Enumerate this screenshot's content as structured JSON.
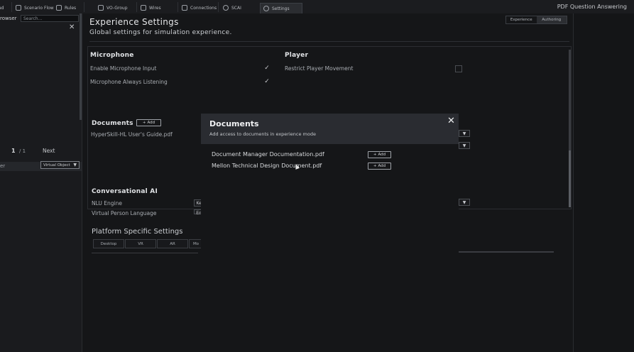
{
  "topbar": {
    "tabs": [
      {
        "label": "ad",
        "icon": "grid-icon"
      },
      {
        "label": "Scenario Flow",
        "icon": "flow-icon"
      },
      {
        "label": "Rules",
        "icon": "rules-icon"
      },
      {
        "label": "VO-Group",
        "icon": "vo-group-icon"
      },
      {
        "label": "Wires",
        "icon": "wires-icon"
      },
      {
        "label": "Connections",
        "icon": "connections-icon"
      },
      {
        "label": "SCAI",
        "icon": "person-icon"
      },
      {
        "label": "Settings",
        "icon": "gear-icon"
      }
    ],
    "right_title": "PDF Question Answering"
  },
  "left_panel": {
    "browser_label": "rowser",
    "search_placeholder": "Search...",
    "close": "✕",
    "page_current": "1",
    "page_total": "/ 1",
    "next_label": "Next",
    "row_label": "er",
    "select_value": "Virtual Object",
    "select_arrow": "▼"
  },
  "header": {
    "title": "Experience Settings",
    "subtitle": "Global settings for simulation experience.",
    "mode_tabs": [
      "Experience",
      "Authoring"
    ]
  },
  "microphone": {
    "title": "Microphone",
    "items": [
      {
        "label": "Enable Microphone Input",
        "checked": true
      },
      {
        "label": "Microphone Always Listening",
        "checked": true
      }
    ]
  },
  "player": {
    "title": "Player",
    "items": [
      {
        "label": "Restrict Player Movement",
        "checked": false
      }
    ]
  },
  "documents": {
    "title": "Documents",
    "add_label": "Add",
    "files": [
      "HyperSkill-HL User's Guide.pdf"
    ]
  },
  "conversational_ai": {
    "title": "Conversational AI",
    "fields": [
      {
        "label": "NLU Engine",
        "value": "Ke"
      },
      {
        "label": "Virtual Person Language",
        "value": "En"
      }
    ]
  },
  "platform": {
    "title": "Platform Specific Settings",
    "tabs": [
      "Desktop",
      "VR",
      "AR",
      "Mo"
    ]
  },
  "modal": {
    "title": "Documents",
    "subtitle": "Add access to documents in experience mode",
    "close": "✕",
    "add_label": "Add",
    "documents": [
      "Document Manager Documentation.pdf",
      "Mellon Technical Design Document.pdf"
    ]
  },
  "dropdown_arrow": "▼",
  "check_mark": "✓",
  "plus_glyph": "+"
}
